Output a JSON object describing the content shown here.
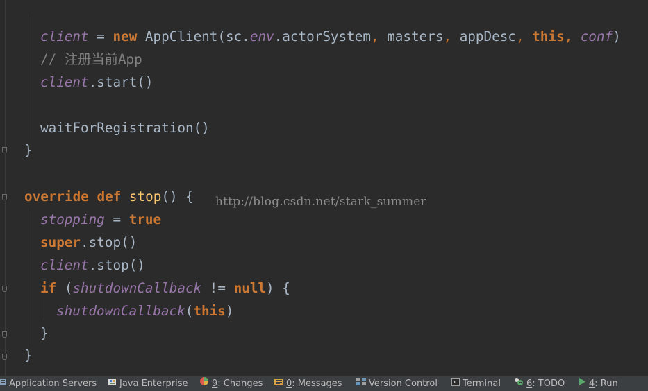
{
  "editor": {
    "watermark": "http://blog.csdn.net/stark_summer",
    "lines": {
      "l1": {
        "a": "client",
        "b": " = ",
        "c": "new",
        "d": " AppClient(sc.",
        "e": "env",
        "f": ".actorSystem",
        "g": ", ",
        "h": "masters",
        "i": ", ",
        "j": "appDesc",
        "k": ", ",
        "l": "this",
        "m": ", ",
        "n": "conf",
        "o": ")"
      },
      "l2": {
        "a": "// 注册当前App"
      },
      "l3": {
        "a": "client",
        "b": ".start()"
      },
      "l4": {
        "a": "waitForRegistration()"
      },
      "l5": {
        "a": "}"
      },
      "l6": {
        "a": "override",
        "b": " ",
        "c": "def",
        "d": " ",
        "e": "stop",
        "f": "() {"
      },
      "l7": {
        "a": "stopping",
        "b": " = ",
        "c": "true"
      },
      "l8": {
        "a": "super",
        "b": ".stop()"
      },
      "l9": {
        "a": "client",
        "b": ".stop()"
      },
      "l10": {
        "a": "if",
        "b": " (",
        "c": "shutdownCallback",
        "d": " != ",
        "e": "null",
        "f": ") {"
      },
      "l11": {
        "a": "shutdownCallback",
        "b": "(",
        "c": "this",
        "d": ")"
      },
      "l12": {
        "a": "}"
      },
      "l13": {
        "a": "}"
      }
    }
  },
  "toolbar": {
    "items": [
      {
        "prefix": "",
        "number": "",
        "label": "Application Servers"
      },
      {
        "prefix": "",
        "number": "",
        "label": "Java Enterprise"
      },
      {
        "prefix": "",
        "number": "9",
        "label": ": Changes"
      },
      {
        "prefix": "",
        "number": "0",
        "label": ": Messages"
      },
      {
        "prefix": "",
        "number": "",
        "label": "Version Control"
      },
      {
        "prefix": "",
        "number": "",
        "label": "Terminal"
      },
      {
        "prefix": "",
        "number": "6",
        "label": ": TODO"
      },
      {
        "prefix": "",
        "number": "4",
        "label": ": Run"
      }
    ]
  },
  "colors": {
    "background": "#2b2b2b",
    "keyword": "#cc7832",
    "function": "#ffc66d",
    "field": "#9876aa",
    "comment": "#808080",
    "text": "#a9b7c6"
  }
}
